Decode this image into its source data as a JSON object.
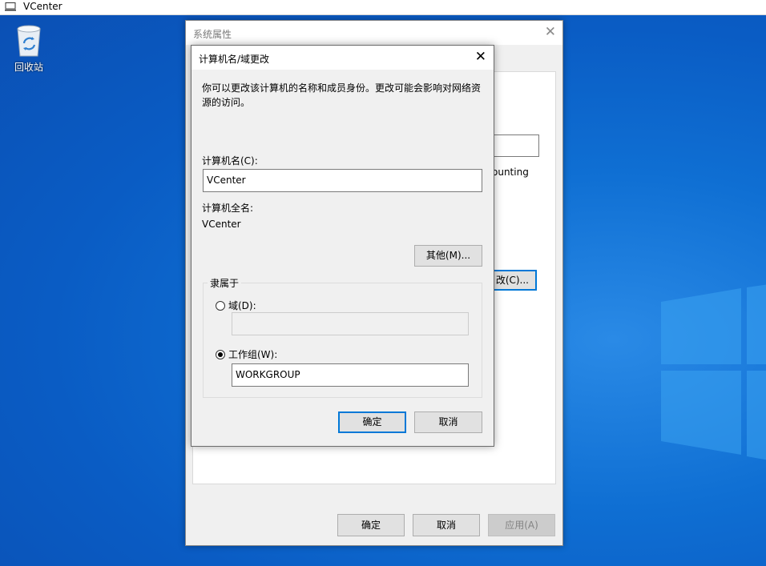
{
  "taskbar": {
    "title": "VCenter"
  },
  "desktop": {
    "recycle_bin_label": "回收站"
  },
  "system_properties": {
    "title": "系统属性",
    "truncated_text": "ounting",
    "change_button": "改(C)...",
    "ok": "确定",
    "cancel": "取消",
    "apply": "应用(A)"
  },
  "dialog": {
    "title": "计算机名/域更改",
    "description": "你可以更改该计算机的名称和成员身份。更改可能会影响对网络资源的访问。",
    "computer_name_label": "计算机名(C):",
    "computer_name_value": "VCenter",
    "full_name_label": "计算机全名:",
    "full_name_value": "VCenter",
    "more_button": "其他(M)...",
    "member_of_label": "隶属于",
    "domain_label": "域(D):",
    "domain_value": "",
    "workgroup_label": "工作组(W):",
    "workgroup_value": "WORKGROUP",
    "selected_membership": "workgroup",
    "ok": "确定",
    "cancel": "取消"
  },
  "colors": {
    "accent": "#0078d7",
    "desktop": "#0f6fd3"
  }
}
